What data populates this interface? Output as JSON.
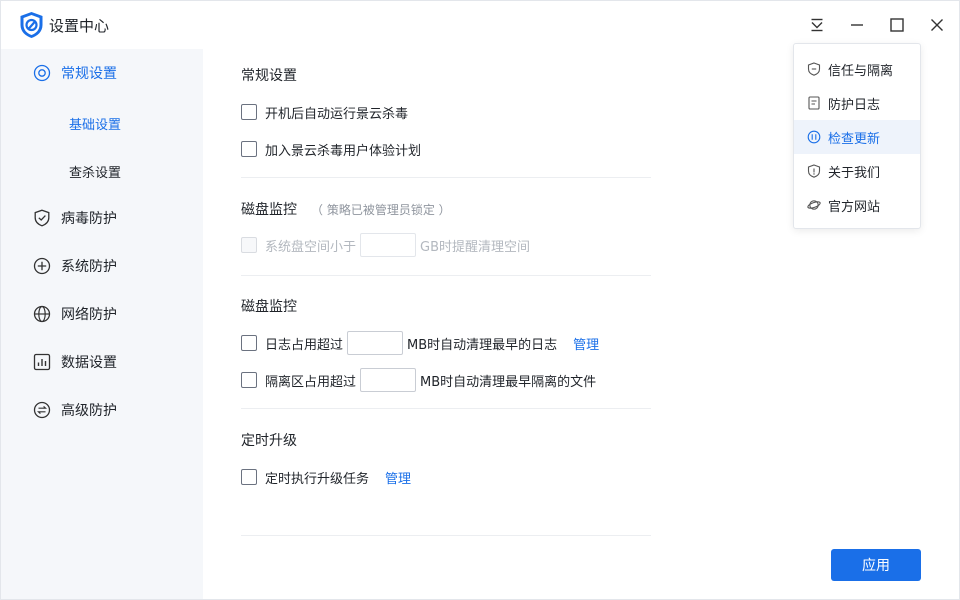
{
  "window": {
    "title": "设置中心"
  },
  "colors": {
    "accent": "#1a6fe8",
    "sidebar_bg": "#f5f7fa",
    "menu_active_bg": "#eef3fb"
  },
  "sidebar": {
    "items": [
      {
        "label": "常规设置",
        "icon": "settings-ring-icon",
        "active": true
      },
      {
        "label": "基础设置",
        "sub": true,
        "active": true
      },
      {
        "label": "查杀设置",
        "sub": true
      },
      {
        "label": "病毒防护",
        "icon": "shield-check-icon"
      },
      {
        "label": "系统防护",
        "icon": "plus-circle-icon"
      },
      {
        "label": "网络防护",
        "icon": "globe-icon"
      },
      {
        "label": "数据设置",
        "icon": "bar-chart-icon"
      },
      {
        "label": "高级防护",
        "icon": "swap-circle-icon"
      }
    ]
  },
  "main": {
    "general": {
      "title": "常规设置",
      "options": [
        "开机后自动运行景云杀毒",
        "加入景云杀毒用户体验计划"
      ]
    },
    "disk_locked": {
      "title": "磁盘监控",
      "note": "（ 策略已被管理员锁定 ）",
      "option_prefix": "系统盘空间小于",
      "option_suffix": "GB时提醒清理空间"
    },
    "disk": {
      "title": "磁盘监控",
      "log_prefix": "日志占用超过",
      "log_suffix": "MB时自动清理最早的日志",
      "log_link": "管理",
      "quarantine_prefix": "隔离区占用超过",
      "quarantine_suffix": "MB时自动清理最早隔离的文件"
    },
    "upgrade": {
      "title": "定时升级",
      "option": "定时执行升级任务",
      "link": "管理"
    },
    "apply_label": "应用"
  },
  "menu": {
    "items": [
      {
        "label": "信任与隔离",
        "icon": "shield-icon"
      },
      {
        "label": "防护日志",
        "icon": "document-icon"
      },
      {
        "label": "检查更新",
        "icon": "update-icon",
        "active": true
      },
      {
        "label": "关于我们",
        "icon": "shield-badge-icon"
      },
      {
        "label": "官方网站",
        "icon": "planet-icon"
      }
    ]
  }
}
